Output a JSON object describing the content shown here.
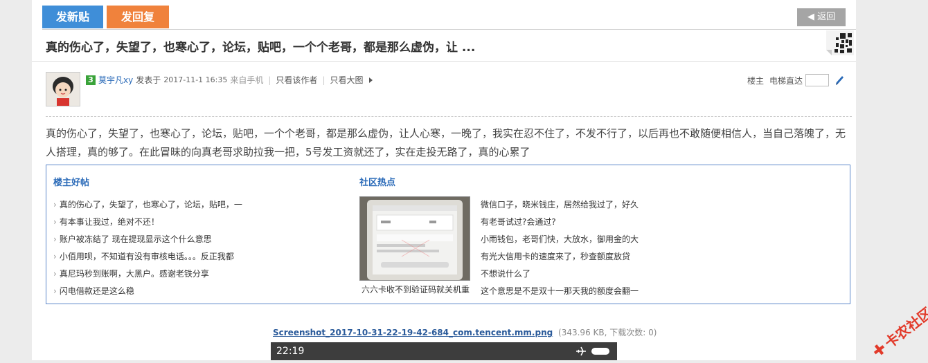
{
  "toolbar": {
    "new_post": "发新贴",
    "reply": "发回复",
    "back": "返回"
  },
  "thread": {
    "title": "真的伤心了，失望了，也寒心了，论坛，贴吧，一个个老哥，都是那么虚伪，让 ..."
  },
  "post": {
    "level": "3",
    "author": "莫宇凡xy",
    "posted_label": "发表于",
    "date": "2017-11-1 16:35",
    "source": "来自手机",
    "only_author": "只看该作者",
    "only_images": "只看大图",
    "floor_label": "楼主",
    "elevator_label": "电梯直达",
    "body": "真的伤心了，失望了，也寒心了，论坛，贴吧，一个个老哥，都是那么虚伪，让人心寒，一晚了，我实在忍不住了，不发不行了，以后再也不敢随便相信人，当自己落魄了，无人搭理，真的够了。在此冒昧的向真老哥求助拉我一把，5号发工资就还了，实在走投无路了，真的心累了"
  },
  "related": {
    "left_title": "楼主好帖",
    "left_items": [
      "真的伤心了，失望了，也寒心了，论坛，贴吧，一",
      "有本事让我过，绝对不还！",
      "账户被冻结了 现在提现显示这个什么意思",
      "小佰用呗，不知道有没有审核电话。。。反正我都",
      "真尼玛秒到账啊，大黑户。感谢老铁分享",
      "闪电借款还是这么稳"
    ],
    "right_title": "社区热点",
    "thumb_caption": "六六卡收不到验证码就关机重",
    "right_items": [
      "微信口子，晓米钱庄，居然给我过了，好久",
      "有老哥试过?会通过?",
      "小雨钱包，老哥们快，大放水，御用金的大",
      "有光大信用卡的速度来了，秒查额度放贷",
      "不想说什么了",
      "这个意思是不是双十一那天我的额度会翻一"
    ]
  },
  "attachment": {
    "name": "Screenshot_2017-10-31-22-19-42-684_com.tencent.mm.png",
    "info": "(343.96 KB, 下载次数: 0)"
  },
  "phone": {
    "time": "22:19"
  },
  "watermark": {
    "text": "卡农社区"
  },
  "colors": {
    "new_post_button": "#3f8ed8",
    "reply_button": "#f0823c",
    "back_button": "#a5a5a5",
    "link": "#2a6ab8",
    "box_border": "#5b86c9"
  }
}
